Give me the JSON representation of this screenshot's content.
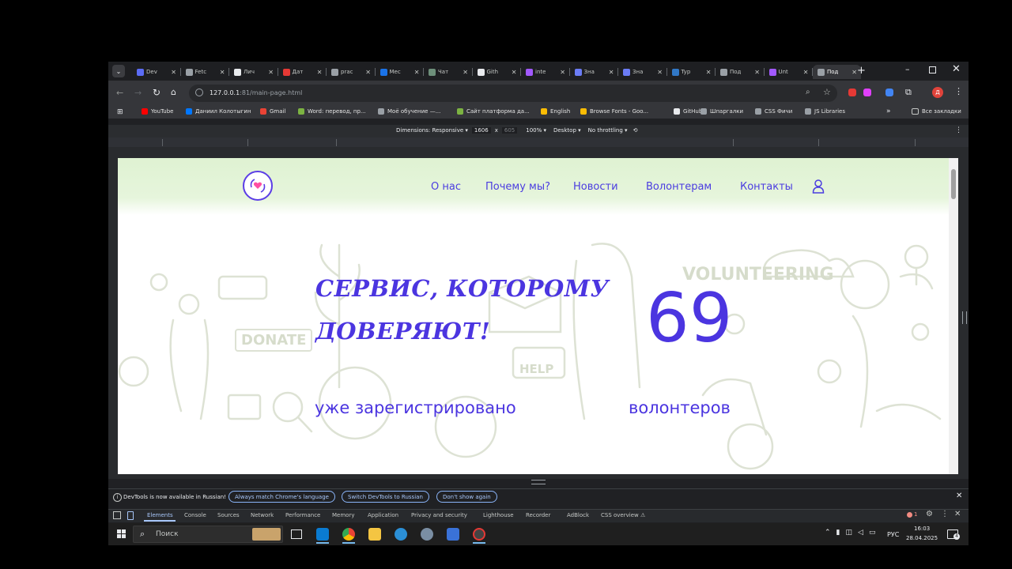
{
  "tabs": [
    {
      "label": "Dev",
      "color": "#5b6cf5"
    },
    {
      "label": "Fetc",
      "color": "#9aa0a6"
    },
    {
      "label": "Лич",
      "color": "#e8eaed"
    },
    {
      "label": "Дат",
      "color": "#e53935"
    },
    {
      "label": "prac",
      "color": "#9aa0a6"
    },
    {
      "label": "Мес",
      "color": "#1a73e8"
    },
    {
      "label": "Чат",
      "color": "#6d8f7a"
    },
    {
      "label": "Gith",
      "color": "#e8eaed"
    },
    {
      "label": "inte",
      "color": "#a259ff"
    },
    {
      "label": "Зна",
      "color": "#6b7cf5"
    },
    {
      "label": "Зна",
      "color": "#6b7cf5"
    },
    {
      "label": "Typ",
      "color": "#3178c6"
    },
    {
      "label": "Под",
      "color": "#9aa0a6"
    },
    {
      "label": "Unt",
      "color": "#a259ff"
    },
    {
      "label": "Под",
      "color": "#9aa0a6"
    }
  ],
  "address": {
    "host": "127.0.0.1",
    "port_path": ":81/main-page.html"
  },
  "bookmarks": [
    {
      "label": "YouTube",
      "color": "#ff0000"
    },
    {
      "label": "Даниил Колотыгин",
      "color": "#0077ff"
    },
    {
      "label": "Gmail",
      "color": "#ea4335"
    },
    {
      "label": "Word: перевод, пр...",
      "color": "#7cb342"
    },
    {
      "label": "Моё обучение —...",
      "color": "#9aa0a6"
    },
    {
      "label": "Сайт платформа да...",
      "color": "#7cb342"
    },
    {
      "label": "English",
      "color": "#fbbc04"
    },
    {
      "label": "Browse Fonts - Goo...",
      "color": "#fbbc04"
    },
    {
      "label": "GitHub",
      "color": "#e8eaed"
    },
    {
      "label": "Шпаргалки",
      "color": "#9aa0a6"
    },
    {
      "label": "CSS Фичи",
      "color": "#9aa0a6"
    },
    {
      "label": "JS Libraries",
      "color": "#9aa0a6"
    }
  ],
  "all_bookmarks": "Все закладки",
  "devbar": {
    "dimensions": "Dimensions: Responsive ▾",
    "width": "1606",
    "x": "x",
    "height": "605",
    "zoom": "100% ▾",
    "device": "Desktop ▾",
    "throttle": "No throttling ▾"
  },
  "site": {
    "nav": [
      "О нас",
      "Почему мы?",
      "Новости",
      "Волонтерам",
      "Контакты"
    ],
    "title_line1": "СЕРВИС, КОТОРОМУ",
    "title_line2": "ДОВЕРЯЮТ!",
    "count": "69",
    "sub_left": "уже зарегистрировано",
    "sub_right": "волонтеров",
    "doodle_volunteering": "VOLUNTEERING",
    "doodle_donate": "DONATE",
    "doodle_help": "HELP",
    "accent": "#4b35e0"
  },
  "devtools": {
    "notice": "DevTools is now available in Russian!",
    "btn_match": "Always match Chrome's language",
    "btn_switch": "Switch DevTools to Russian",
    "btn_dont": "Don't show again",
    "tabs": [
      "Elements",
      "Console",
      "Sources",
      "Network",
      "Performance",
      "Memory",
      "Application",
      "Privacy and security",
      "Lighthouse",
      "Recorder",
      "AdBlock",
      "CSS overview ⚠"
    ],
    "error_count": "1"
  },
  "taskbar": {
    "search": "Поиск",
    "lang": "РУС",
    "time": "16:03",
    "date": "28.04.2025",
    "notif": "4"
  }
}
